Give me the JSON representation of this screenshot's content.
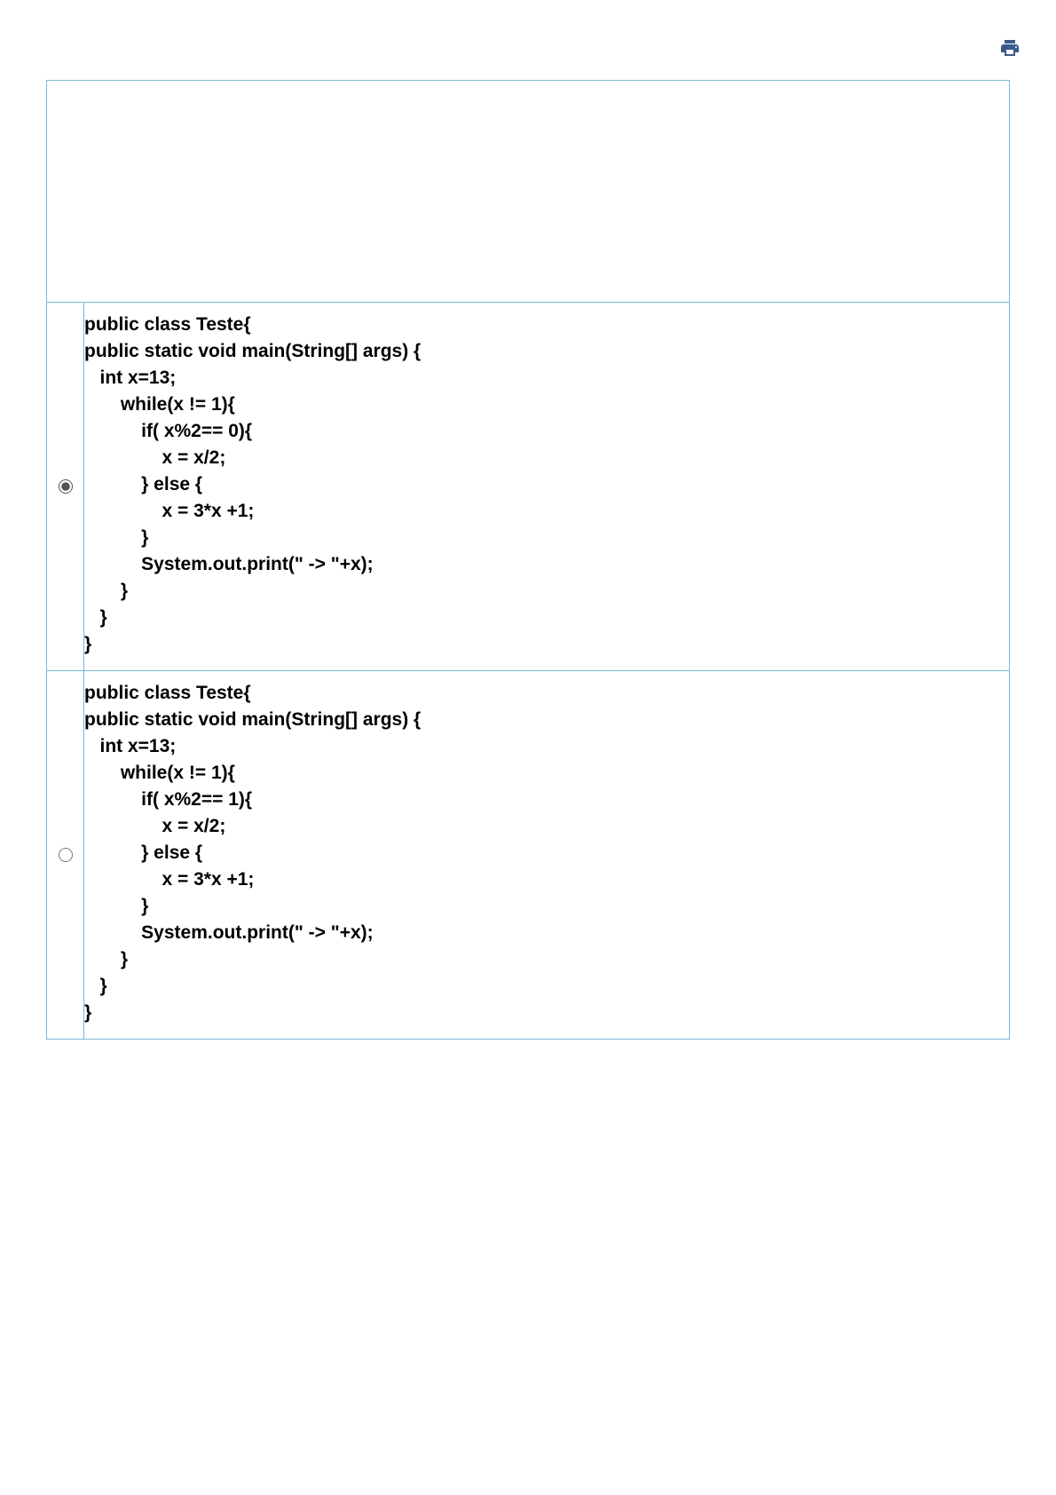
{
  "options": [
    {
      "selected": true,
      "code": [
        "public class Teste{",
        "public static void main(String[] args) {",
        "   int x=13;",
        "       while(x != 1){",
        "           if( x%2== 0){",
        "               x = x/2;",
        "           } else {",
        "               x = 3*x +1;",
        "           }",
        "           System.out.print(\" -> \"+x);",
        "       }",
        "   }",
        "}"
      ]
    },
    {
      "selected": false,
      "code": [
        "public class Teste{",
        "public static void main(String[] args) {",
        "   int x=13;",
        "       while(x != 1){",
        "           if( x%2== 1){",
        "               x = x/2;",
        "           } else {",
        "               x = 3*x +1;",
        "           }",
        "           System.out.print(\" -> \"+x);",
        "       }",
        "   }",
        "}"
      ]
    }
  ]
}
